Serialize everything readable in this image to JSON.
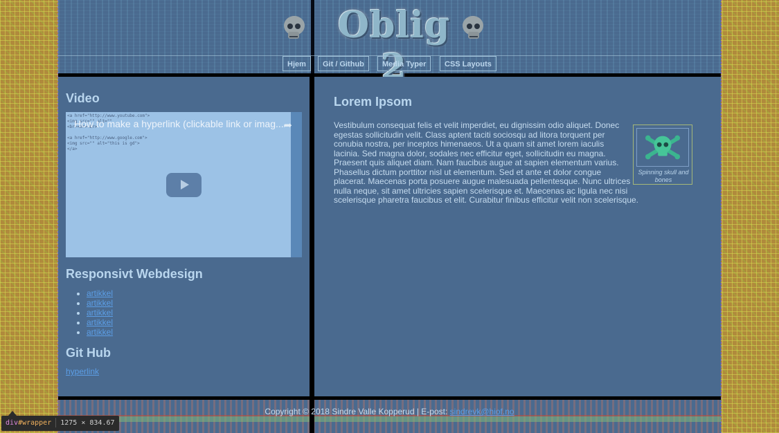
{
  "header": {
    "logo_text": "Oblig 2",
    "skull_icons": [
      "skull-icon",
      "skull-icon"
    ]
  },
  "nav": {
    "items": [
      {
        "label": "Hjem"
      },
      {
        "label": "Git / Github"
      },
      {
        "label": "Media Typer"
      },
      {
        "label": "CSS Layouts"
      }
    ]
  },
  "sidebar": {
    "video_heading": "Video",
    "video_title": "How to make a hyperlink (clickable link or imag...",
    "video_code": "<a href=\"http://www.youtube.com\">\n<img src=\"\" alt=\"\"\n<br><br><br>\n\n<a href=\"http://www.google.com\">\n<img src=\"\" alt=\"this is gd\">\n</a>",
    "responsive_heading": "Responsivt Webdesign",
    "links": [
      {
        "label": "artikkel"
      },
      {
        "label": "artikkel"
      },
      {
        "label": "artikkel"
      },
      {
        "label": "artikkel"
      },
      {
        "label": "artikkel"
      }
    ],
    "github_heading": "Git Hub",
    "github_link": "hyperlink"
  },
  "main": {
    "heading": "Lorem Ipsom",
    "figure_caption": "Spinning skull and bones",
    "body": "Vestibulum consequat felis et velit imperdiet, eu dignissim odio aliquet. Donec egestas sollicitudin velit. Class aptent taciti sociosqu ad litora torquent per conubia nostra, per inceptos himenaeos. Ut a quam sit amet lorem iaculis lacinia. Sed magna dolor, sodales nec efficitur eget, sollicitudin eu magna. Praesent quis aliquet diam. Nam faucibus augue at sapien elementum varius. Phasellus dictum porttitor nisl ut elementum. Sed et ante et dolor congue placerat. Maecenas porta posuere augue malesuada pellentesque. Nunc ultrices nulla neque, sit amet ultricies sapien scelerisque et. Maecenas ac ligula nec nisi scelerisque pharetra faucibus et elit. Curabitur finibus efficitur velit non scelerisque."
  },
  "footer": {
    "copyright": "Copyright © 2018 Sindre Valle Kopperud | E-post: ",
    "email": "sindrevk@hiof.no"
  },
  "devtools": {
    "tag": "div",
    "id": "#wrapper",
    "size": "1275 × 834.67"
  },
  "colors": {
    "panel": "#4a6a8f",
    "heading": "#b9d6ee",
    "link": "#5c9ee6",
    "background": "#b08a3c"
  }
}
